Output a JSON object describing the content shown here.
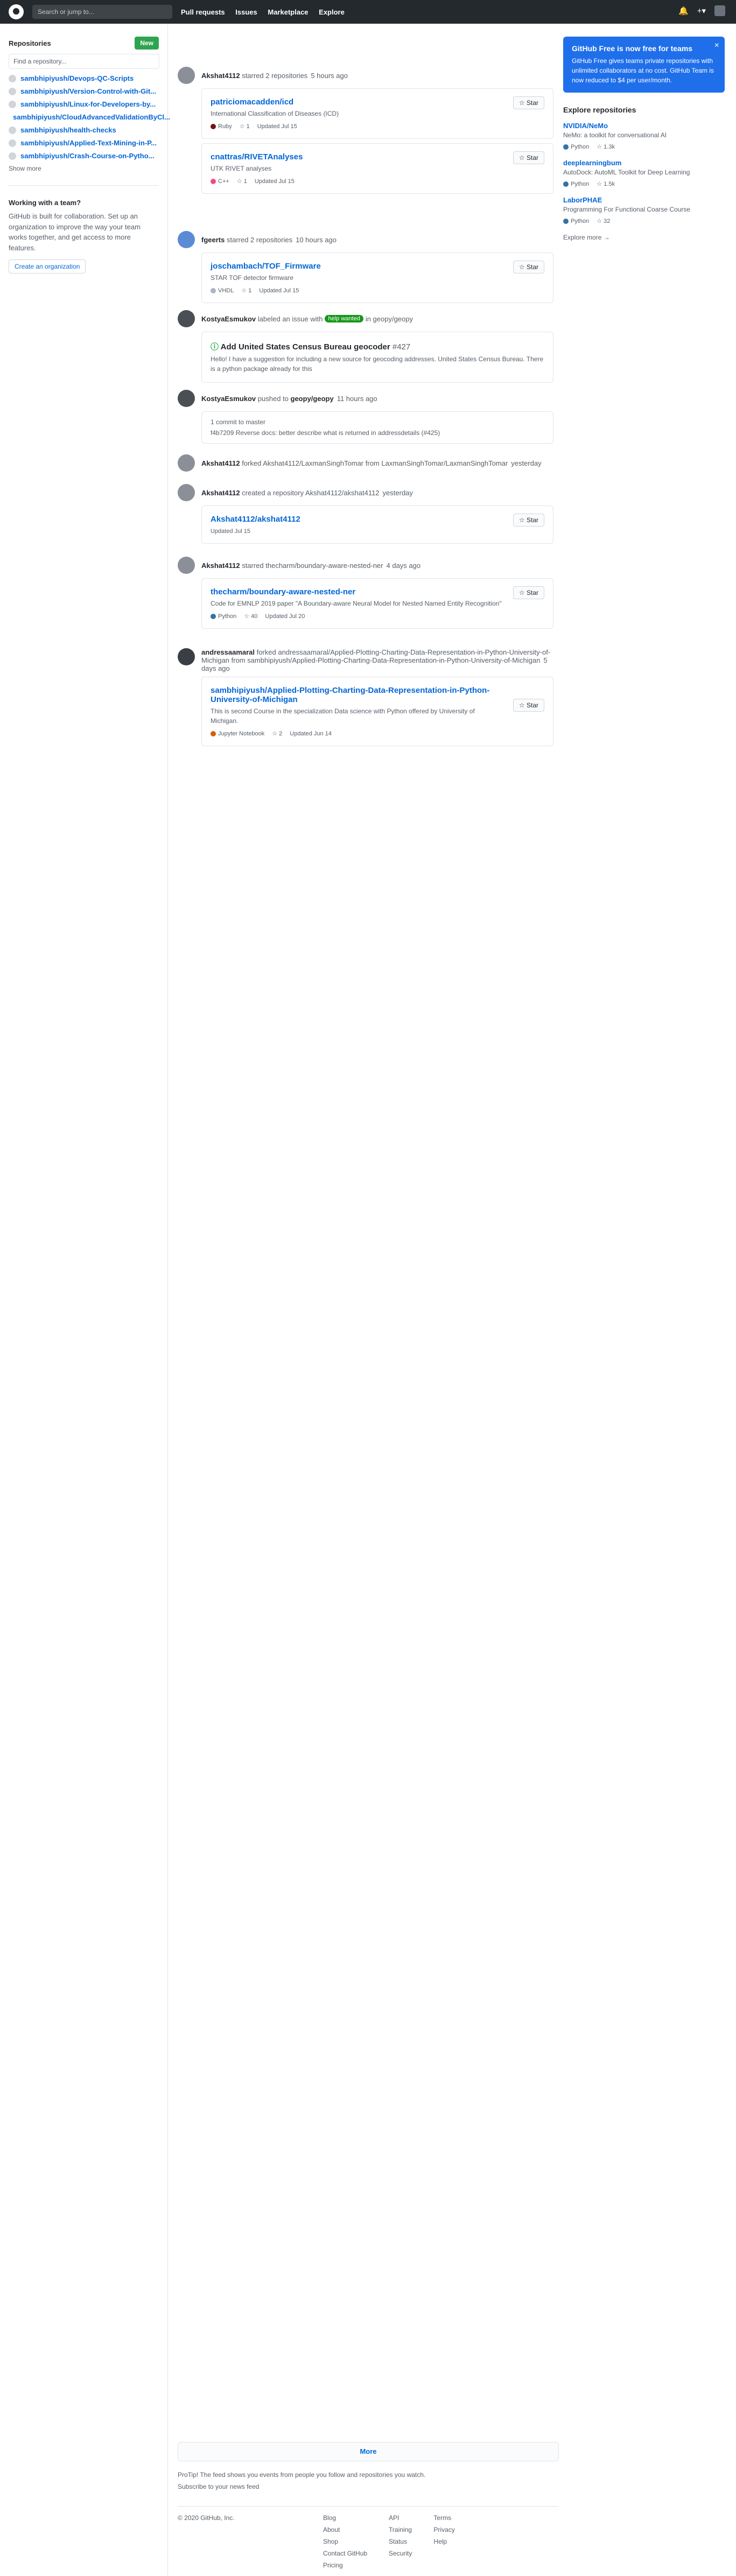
{
  "topbar": {
    "search_placeholder": "Search or jump to...",
    "nav": [
      "Pull requests",
      "Issues",
      "Marketplace",
      "Explore"
    ]
  },
  "sidebar": {
    "title": "Repositories",
    "new_label": "New",
    "filter_placeholder": "Find a repository...",
    "repos": [
      "sambhipiyush/Devops-QC-Scripts",
      "sambhipiyush/Version-Control-with-Git...",
      "sambhipiyush/Linux-for-Developers-by...",
      "sambhipiyush/CloudAdvancedValidationByCl...",
      "sambhipiyush/health-checks",
      "sambhipiyush/Applied-Text-Mining-in-P...",
      "sambhipiyush/Crash-Course-on-Pytho..."
    ],
    "show_more": "Show more",
    "team_title": "Working with a team?",
    "team_text": "GitHub is built for collaboration. Set up an organization to improve the way your team works together, and get access to more features.",
    "create_org": "Create an organization"
  },
  "right": {
    "promo_title": "GitHub Free is now free for teams",
    "promo_text": "GitHub Free gives teams private repositories with unlimited collaborators at no cost. GitHub Team is now reduced to $4 per user/month.",
    "explore_title": "Explore repositories",
    "explore": [
      {
        "name": "NVIDIA/NeMo",
        "desc": "NeMo: a toolkit for conversational AI",
        "lang": "Python",
        "stars": "1.3k"
      },
      {
        "name": "deeplearningbum",
        "desc": "AutoDock: AutoML Toolkit for Deep Learning",
        "lang": "Python",
        "stars": "1.5k"
      },
      {
        "name": "LaborPHAE",
        "desc": "Programming For Functional Coarse Course",
        "lang": "Python",
        "stars": "32"
      }
    ],
    "explore_more": "Explore more →"
  },
  "events": [
    {
      "who": "Akshat4112",
      "action": "starred 2 repositories",
      "time": "5 hours ago",
      "cards": [
        {
          "name": "patriciomacadden/icd",
          "desc": "International Classification of Diseases (ICD)",
          "lang": "Ruby",
          "lc": "#701516",
          "stars": "1",
          "updated": "Updated Jul 15"
        },
        {
          "name": "cnattras/RIVETAnalyses",
          "desc": "UTK RIVET analyses",
          "lang": "C++",
          "lc": "#f34b7d",
          "stars": "1",
          "updated": "Updated Jul 15"
        }
      ]
    },
    {
      "who": "fgeerts",
      "action": "starred 2 repositories",
      "time": "10 hours ago",
      "cards": [
        {
          "name": "joschambach/TOF_Firmware",
          "desc": "STAR TOF detector firmware",
          "lang": "VHDL",
          "lc": "#adb2cb",
          "stars": "1",
          "updated": "Updated Jul 15"
        }
      ]
    },
    {
      "who": "KostyaEsmukov",
      "action": "labeled an issue with",
      "label": "help wanted",
      "tail": "in geopy/geopy",
      "time": "",
      "issue": "Add United States Census Bureau geocoder",
      "num": "#427",
      "body": "Hello! I have a suggestion for including a new source for geocoding addresses. United States Census Bureau. There is a python package already for this"
    },
    {
      "who": "KostyaEsmukov",
      "action": "pushed to",
      "repo": "geopy/geopy",
      "time": "11 hours ago",
      "commits": [
        "1 commit to master",
        "f4b7209 Reverse docs: better describe what is returned in addressdetails (#425)"
      ]
    },
    {
      "who": "Akshat4112",
      "action": "forked Akshat4112/LaxmanSinghTomar from LaxmanSinghTomar/LaxmanSinghTomar",
      "time": "yesterday"
    },
    {
      "who": "Akshat4112",
      "action": "created a repository Akshat4112/akshat4112",
      "time": "yesterday",
      "cards": [
        {
          "name": "Akshat4112/akshat4112",
          "desc": "",
          "updated": "Updated Jul 15"
        }
      ]
    },
    {
      "who": "Akshat4112",
      "action": "starred thecharm/boundary-aware-nested-ner",
      "time": "4 days ago",
      "cards": [
        {
          "name": "thecharm/boundary-aware-nested-ner",
          "desc": "Code for EMNLP 2019 paper \"A Boundary-aware Neural Model for Nested Named Entity Recognition\"",
          "lang": "Python",
          "lc": "#3572A5",
          "stars": "40",
          "updated": "Updated Jul 20"
        }
      ]
    },
    {
      "who": "andressaamaral",
      "action": "forked andressaamaral/Applied-Plotting-Charting-Data-Representation-in-Python-University-of-Michigan from sambhipiyush/Applied-Plotting-Charting-Data-Representation-in-Python-University-of-Michigan",
      "time": "5 days ago",
      "cards": [
        {
          "name": "sambhipiyush/Applied-Plotting-Charting-Data-Representation-in-Python-University-of-Michigan",
          "desc": "This is second Course in the specialization Data science with Python offered by University of Michigan.",
          "lang": "Jupyter Notebook",
          "lc": "#DA5B0B",
          "stars": "2",
          "updated": "Updated Jun 14"
        }
      ]
    }
  ],
  "more": "More",
  "protip": "ProTip! The feed shows you events from people you follow and repositories you watch.",
  "subscribe": "Subscribe to your news feed",
  "footer": {
    "copy": "© 2020 GitHub, Inc.",
    "col1": [
      "Blog",
      "About",
      "Shop",
      "Contact GitHub",
      "Pricing"
    ],
    "col2": [
      "API",
      "Training",
      "Status",
      "Security"
    ],
    "col3": [
      "Terms",
      "Privacy",
      "Help"
    ]
  },
  "star_label": "Star"
}
